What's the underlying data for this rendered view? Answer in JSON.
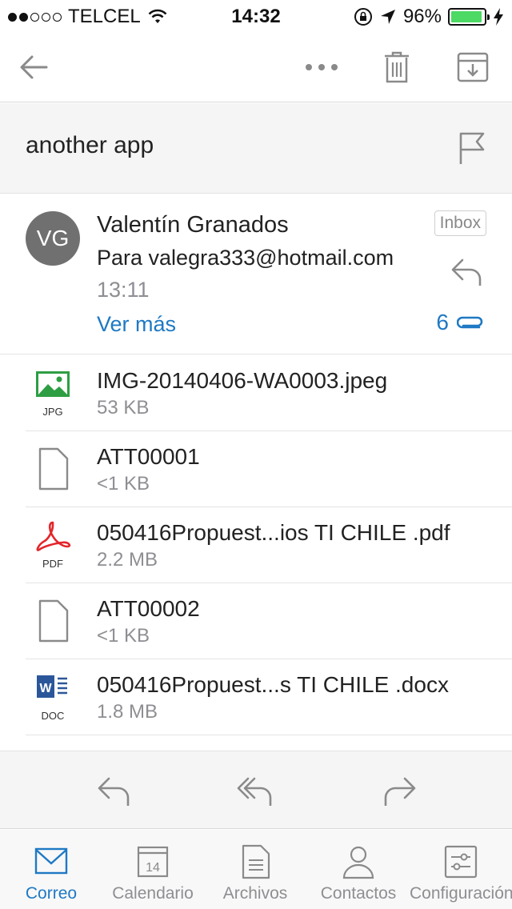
{
  "status_bar": {
    "carrier": "TELCEL",
    "signal_bars_filled": 2,
    "signal_bars_total": 5,
    "time": "14:32",
    "battery_percent_text": "96%",
    "battery_level": 0.96,
    "battery_color": "#4cd964"
  },
  "toolbar": {
    "back_icon": "arrow-left-icon",
    "more_icon": "more-dots-icon",
    "delete_icon": "trash-icon",
    "archive_icon": "archive-icon"
  },
  "subject": {
    "title": "another app",
    "flag_icon": "flag-icon"
  },
  "message": {
    "avatar_initials": "VG",
    "sender_name": "Valentín Granados",
    "recipient_line": "Para valegra333@hotmail.com",
    "time": "13:11",
    "see_more": "Ver más",
    "folder_badge": "Inbox",
    "attachment_count": "6",
    "accent_color": "#1f79c4"
  },
  "attachments": [
    {
      "name": "IMG-20140406-WA0003.jpeg",
      "size": "53 KB",
      "type_label": "JPG",
      "icon": "image-file-icon"
    },
    {
      "name": "ATT00001",
      "size": "<1 KB",
      "type_label": "",
      "icon": "generic-file-icon"
    },
    {
      "name": "050416Propuest...ios TI CHILE .pdf",
      "size": "2.2 MB",
      "type_label": "PDF",
      "icon": "pdf-file-icon"
    },
    {
      "name": "ATT00002",
      "size": "<1 KB",
      "type_label": "",
      "icon": "generic-file-icon"
    },
    {
      "name": "050416Propuest...s TI CHILE .docx",
      "size": "1.8 MB",
      "type_label": "DOC",
      "icon": "word-file-icon"
    }
  ],
  "actions": {
    "reply_icon": "reply-icon",
    "reply_all_icon": "reply-all-icon",
    "forward_icon": "forward-icon"
  },
  "tabs": [
    {
      "label": "Correo",
      "icon": "mail-icon",
      "active": true
    },
    {
      "label": "Calendario",
      "icon": "calendar-icon",
      "calendar_day": "14",
      "active": false
    },
    {
      "label": "Archivos",
      "icon": "file-icon",
      "active": false
    },
    {
      "label": "Contactos",
      "icon": "person-icon",
      "active": false
    },
    {
      "label": "Configuración",
      "icon": "settings-sliders-icon",
      "active": false
    }
  ]
}
